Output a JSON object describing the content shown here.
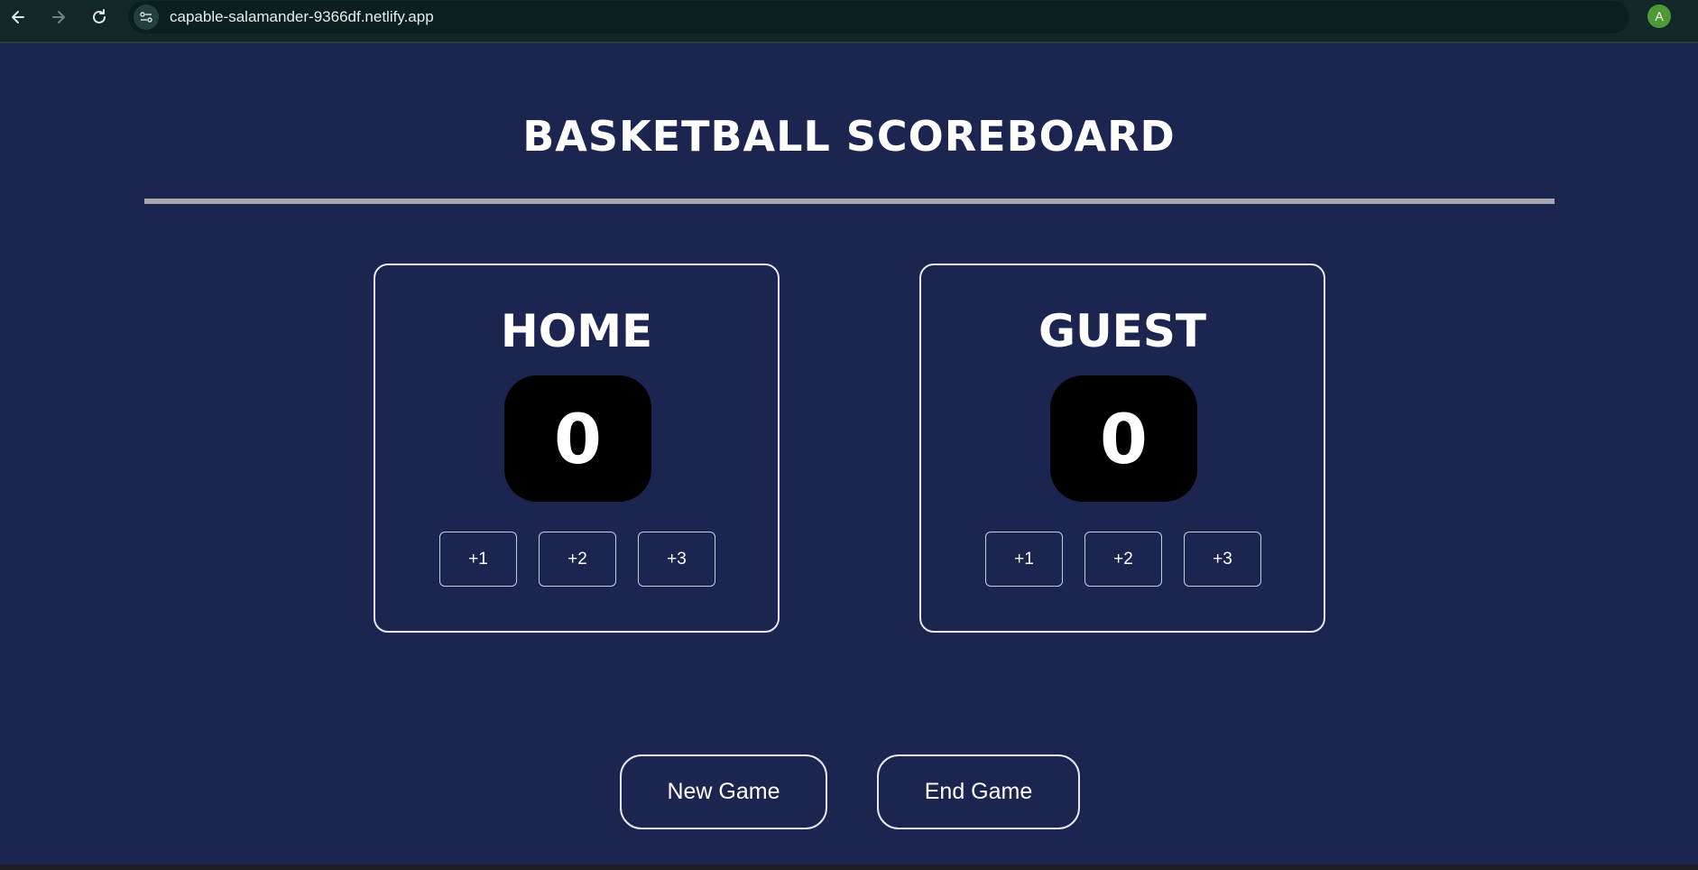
{
  "browser": {
    "url": "capable-salamander-9366df.netlify.app",
    "profile_initial": "A"
  },
  "page": {
    "title": "BASKETBALL SCOREBOARD"
  },
  "teams": [
    {
      "name": "HOME",
      "score": "0",
      "buttons": [
        "+1",
        "+2",
        "+3"
      ]
    },
    {
      "name": "GUEST",
      "score": "0",
      "buttons": [
        "+1",
        "+2",
        "+3"
      ]
    }
  ],
  "controls": {
    "new_game_label": "New Game",
    "end_game_label": "End Game"
  },
  "colors": {
    "background": "#1c2450",
    "score_box": "#000000",
    "divider": "#a9a6ad",
    "browser_bar": "#122828",
    "avatar": "#4d9a34"
  }
}
